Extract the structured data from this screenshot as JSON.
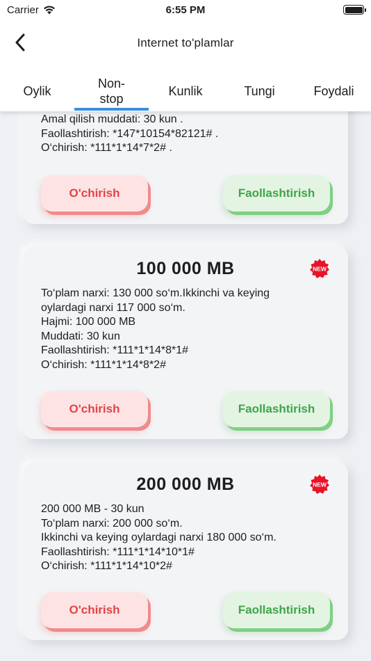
{
  "status_bar": {
    "carrier": "Carrier",
    "time": "6:55 PM"
  },
  "header": {
    "title": "Internet to'plamlar"
  },
  "tabs": [
    {
      "label": "Oylik"
    },
    {
      "label": "Non-\nstop"
    },
    {
      "label": "Kunlik"
    },
    {
      "label": "Tungi"
    },
    {
      "label": "Foydali"
    }
  ],
  "active_tab": "Non-stop",
  "colors": {
    "accent": "#3d8be0",
    "deactivate": "#e04446",
    "activate": "#3fa548",
    "badge": "#e8132a"
  },
  "cards": [
    {
      "title": "",
      "lines": [
        "Amal qilish muddati: 30 kun .",
        "Faollashtirish: *147*10154*82121# .",
        "O‘chirish: *111*1*14*7*2# ."
      ],
      "deactivate_label": "O'chirish",
      "activate_label": "Faollashtirish"
    },
    {
      "title": "100 000 MB",
      "badge": "NEW",
      "lines": [
        "To‘plam narxi:  130 000 so‘m.Ikkinchi va keying",
        "oylardagi narxi 117 000 so‘m.",
        "Hajmi: 100 000 MB",
        "Muddati: 30 kun",
        "Faollashtirish:  *111*1*14*8*1#",
        "O‘chirish:  *111*1*14*8*2#"
      ],
      "deactivate_label": "O'chirish",
      "activate_label": "Faollashtirish"
    },
    {
      "title": "200 000 MB",
      "badge": "NEW",
      "lines": [
        "200 000 MB - 30 kun",
        "To‘plam narxi:  200 000 so‘m.",
        "Ikkinchi va keying oylardagi narxi 180 000 so‘m.",
        "Faollashtirish:  *111*1*14*10*1#",
        "O‘chirish:  *111*1*14*10*2#"
      ],
      "deactivate_label": "O'chirish",
      "activate_label": "Faollashtirish"
    }
  ]
}
